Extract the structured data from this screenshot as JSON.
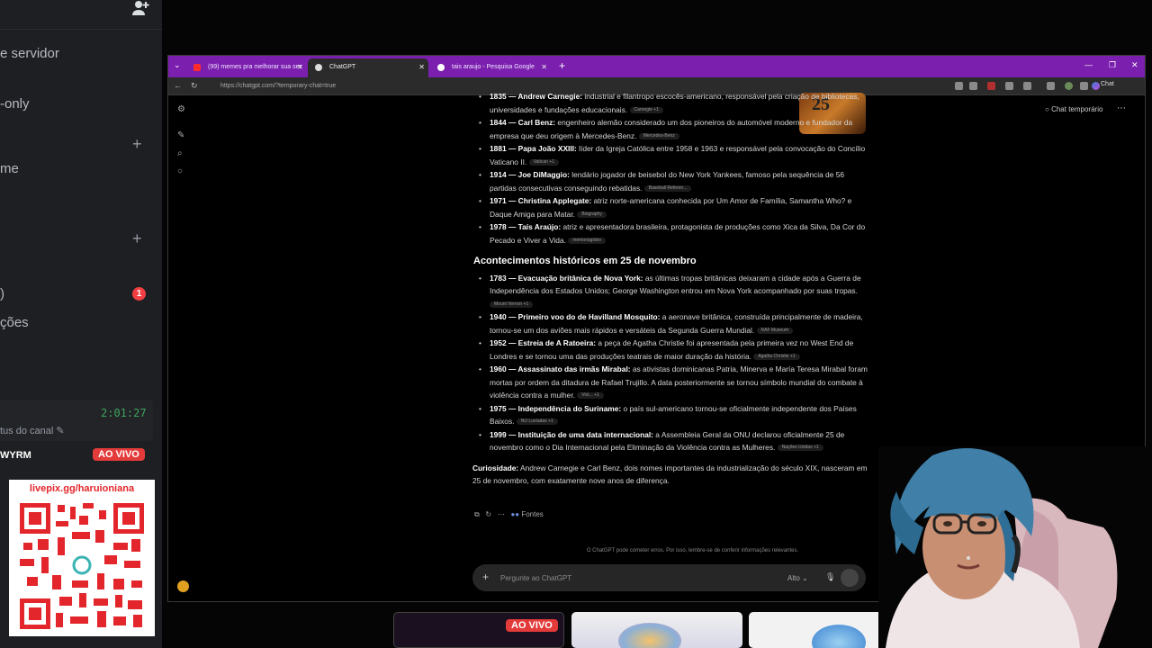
{
  "discord": {
    "items": [
      {
        "label": "e servidor"
      },
      {
        "label": "-only"
      },
      {
        "label": "me"
      },
      {
        "label": "ções"
      }
    ],
    "badge": "1",
    "timer": "2:01:27",
    "status": "tus do canal",
    "user": "WYRM",
    "live_label": "AO VIVO"
  },
  "qr": {
    "url": "livepix.gg/haruioniana"
  },
  "browser": {
    "tabs": [
      {
        "label": "(99) memes pra melhorar sua ser",
        "favicon_color": "#ff2b2b"
      },
      {
        "label": "ChatGPT",
        "favicon_color": "#dddddd"
      },
      {
        "label": "tais araujo - Pesquisa Google",
        "favicon_color": "#ffffff"
      }
    ],
    "url": "https://chatgpt.com/?temporary-chat=true",
    "chat_button": "Chat"
  },
  "chatgpt": {
    "temp_chat_label": "Chat temporário",
    "image_text": "25",
    "births": [
      {
        "bold": "1835 — Andrew Carnegie:",
        "text": " industrial e filantropo escocês-americano, responsável pela criação de bibliotecas, universidades e fundações educacionais.",
        "cite": "Carnegie +1"
      },
      {
        "bold": "1844 — Carl Benz:",
        "text": " engenheiro alemão considerado um dos pioneiros do automóvel moderno e fundador da empresa que deu origem à Mercedes-Benz.",
        "cite": "Mercedes-Benz"
      },
      {
        "bold": "1881 — Papa João XXIII:",
        "text": " líder da Igreja Católica entre 1958 e 1963 e responsável pela convocação do Concílio Vaticano II.",
        "cite": "Vatican +1"
      },
      {
        "bold": "1914 — Joe DiMaggio:",
        "text": " lendário jogador de beisebol do New York Yankees, famoso pela sequência de 56 partidas consecutivas conseguindo rebatidas.",
        "cite": "Baseball Referen..."
      },
      {
        "bold": "1971 — Christina Applegate:",
        "text": " atriz norte-americana conhecida por Um Amor de Família, Samantha Who? e Daque Amiga para Matar.",
        "cite": "Biography"
      },
      {
        "bold": "1978 — Taís Araújo:",
        "text": " atriz e apresentadora brasileira, protagonista de produções como Xica da Silva, Da Cor do Pecado e Viver a Vida.",
        "cite": "memoriaglobo"
      }
    ],
    "events_heading": "Acontecimentos históricos em 25 de novembro",
    "events": [
      {
        "bold": "1783 — Evacuação britânica de Nova York:",
        "text": " as últimas tropas britânicas deixaram a cidade após a Guerra de Independência dos Estados Unidos; George Washington entrou em Nova York acompanhado por suas tropas.",
        "cite": "Mount Vernon +1"
      },
      {
        "bold": "1940 — Primeiro voo do de Havilland Mosquito:",
        "text": " a aeronave britânica, construída principalmente de madeira, tornou-se um dos aviões mais rápidos e versáteis da Segunda Guerra Mundial.",
        "cite": "RAF Museum"
      },
      {
        "bold": "1952 — Estreia de A Ratoeira:",
        "text": " a peça de Agatha Christie foi apresentada pela primeira vez no West End de Londres e se tornou uma das produções teatrais de maior duração da história.",
        "cite": "Agatha Christie +1"
      },
      {
        "bold": "1960 — Assassinato das irmãs Mirabal:",
        "text": " as ativistas dominicanas Patria, Minerva e María Teresa Mirabal foram mortas por ordem da ditadura de Rafael Trujillo. A data posteriormente se tornou símbolo mundial do combate à violência contra a mulher.",
        "cite": "Vict... +1"
      },
      {
        "bold": "1975 — Independência do Suriname:",
        "text": " o país sul-americano tornou-se oficialmente independente dos Países Baixos.",
        "cite": "NU Lusíadas +1"
      },
      {
        "bold": "1999 — Instituição de uma data internacional:",
        "text": " a Assembleia Geral da ONU declarou oficialmente 25 de novembro como o Dia Internacional pela Eliminação da Violência contra as Mulheres.",
        "cite": "Nações Unidas +1"
      }
    ],
    "curiosity_bold": "Curiosidade:",
    "curiosity_text": " Andrew Carnegie e Carl Benz, dois nomes importantes da industrialização do século XIX, nasceram em 25 de novembro, com exatamente nove anos de diferença.",
    "sources_label": "Fontes",
    "disclaimer": "O ChatGPT pode cometer erros. Por isso, lembre-se de conferir informações relevantes.",
    "composer_placeholder": "Pergunte ao ChatGPT",
    "model_label": "Alto"
  },
  "bottom": {
    "live_label": "AO VIVO"
  }
}
